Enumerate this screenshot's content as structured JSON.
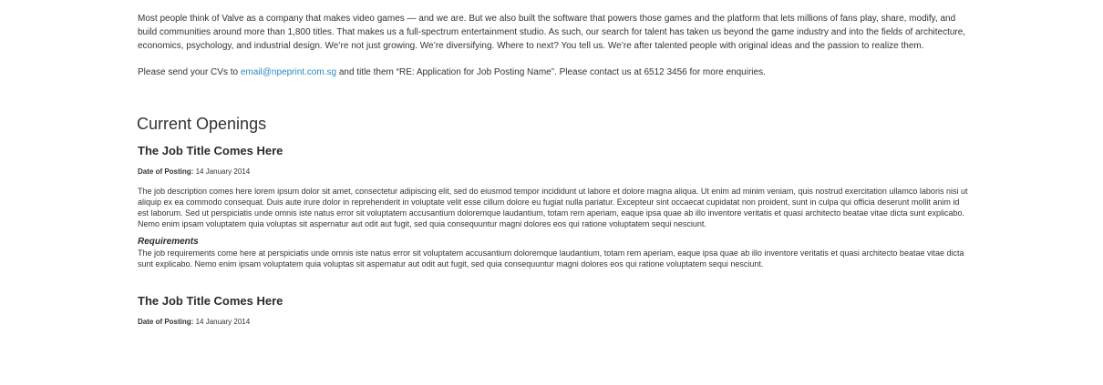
{
  "intro": {
    "paragraph": "Most people think of Valve as a company that makes video games — and we are. But we also built the software that powers those games and the platform that lets millions of fans play, share, modify, and build communities around more than 1,800 titles. That makes us a full-spectrum entertainment studio. As such, our search for talent has taken us beyond the game industry and into the fields of architecture, economics, psychology, and industrial design. We’re not just growing. We’re diversifying. Where to next? You tell us. We’re after talented people with original ideas and the passion to realize them.",
    "cv_prefix": "Please send your CVs to ",
    "cv_email": "email@npeprint.com.sg",
    "cv_suffix": " and title them “RE: Application for Job Posting Name”. Please contact us at 6512 3456 for more enquiries."
  },
  "openings": {
    "heading": "Current Openings",
    "jobs": [
      {
        "title": "The Job Title Comes Here",
        "posting_label": "Date of Posting:",
        "posting_date": " 14 January 2014",
        "description": "The job description comes here lorem ipsum dolor sit amet, consectetur adipiscing elit, sed do eiusmod tempor incididunt ut labore et dolore magna aliqua. Ut enim ad minim veniam, quis nostrud exercitation ullamco laboris nisi ut aliquip ex ea commodo consequat. Duis aute irure dolor in reprehenderit in voluptate velit esse cillum dolore eu fugiat nulla pariatur. Excepteur sint occaecat cupidatat non proident, sunt in culpa qui officia deserunt mollit anim id est laborum. Sed ut perspiciatis unde omnis iste natus error sit voluptatem accusantium doloremque laudantium, totam rem aperiam, eaque ipsa quae ab illo inventore veritatis et quasi architecto beatae vitae dicta sunt explicabo. Nemo enim ipsam voluptatem quia voluptas sit aspernatur aut odit aut fugit, sed quia consequuntur magni dolores eos qui ratione voluptatem sequi nesciunt.",
        "requirements_heading": "Requirements",
        "requirements": "The job requirements come here at perspiciatis unde omnis iste natus error sit voluptatem accusantium doloremque laudantium, totam rem aperiam, eaque ipsa quae ab illo inventore veritatis et quasi architecto beatae vitae dicta sunt explicabo. Nemo enim ipsam voluptatem quia voluptas sit aspernatur aut odit aut fugit, sed quia consequuntur magni dolores eos qui ratione voluptatem sequi nesciunt."
      },
      {
        "title": "The Job Title Comes Here",
        "posting_label": "Date of Posting:",
        "posting_date": " 14 January 2014"
      }
    ]
  },
  "colors": {
    "link": "#2a8ac6",
    "text": "#333333"
  }
}
